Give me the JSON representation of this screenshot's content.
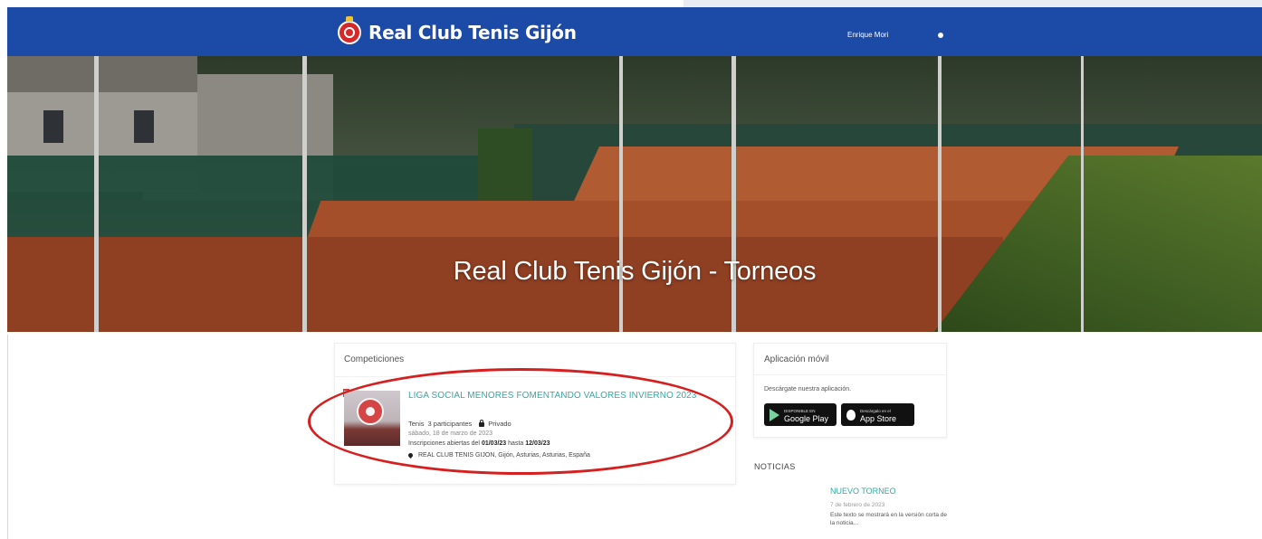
{
  "navbar": {
    "brand": "Real Club Tenis Gijón",
    "user": "Enrique Mori",
    "background_color": "#1b4aa7"
  },
  "hero": {
    "title": "Real Club Tenis Gijón - Torneos"
  },
  "competitions": {
    "header": "Competiciones",
    "items": [
      {
        "title": "LIGA SOCIAL MENORES FOMENTANDO VALORES INVIERNO 2023",
        "sport": "Tenis",
        "participants": "3 participantes",
        "privacy": "Privado",
        "date": "sábado, 18 de marzo de 2023",
        "registration_prefix": "Inscripciones abiertas del",
        "registration_from": "01/03/23",
        "registration_middle": "hasta",
        "registration_to": "12/03/23",
        "location": "REAL CLUB TENIS GIJON, Gijón, Asturias, Asturias, España"
      }
    ]
  },
  "app": {
    "header": "Aplicación móvil",
    "description": "Descárgate nuestra aplicación.",
    "google_small": "DISPONIBLE EN",
    "google_label": "Google Play",
    "apple_small": "Descárgalo en el",
    "apple_label": "App Store"
  },
  "news": {
    "header": "NOTICIAS",
    "items": [
      {
        "title": "NUEVO TORNEO",
        "date": "7 de febrero de 2023",
        "body": "Este texto se mostrará en la versión corta de la noticia..."
      }
    ]
  },
  "colors": {
    "accent_teal": "#3aa6a2",
    "annotation_red": "#d61f1f"
  }
}
